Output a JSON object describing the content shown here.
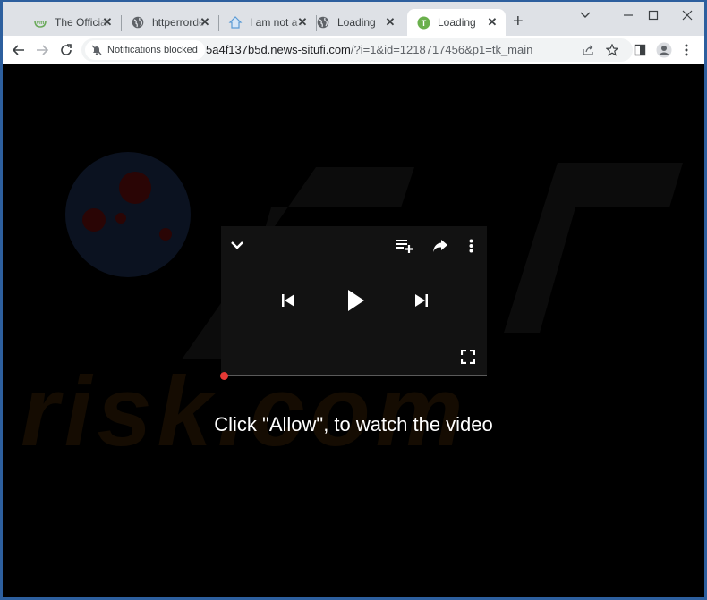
{
  "browser": {
    "tabs": [
      {
        "title": "The Official",
        "favicon": "vm-logo-icon",
        "active": false
      },
      {
        "title": "httperrorde",
        "favicon": "globe-icon",
        "active": false
      },
      {
        "title": "I am not a ro",
        "favicon": "house-icon",
        "active": false
      },
      {
        "title": "Loading",
        "favicon": "globe-icon",
        "active": false
      },
      {
        "title": "Loading",
        "favicon": "green-t-icon",
        "active": true
      }
    ],
    "new_tab_label": "+",
    "notifications_chip": "Notifications blocked",
    "url_host": "5a4f137b5d.news-situfi.com",
    "url_rest": "/?i=1&id=1218717456&p1=tk_main"
  },
  "page": {
    "cta_text": "Click \"Allow\", to watch the video",
    "watermark_text": "risk.com",
    "player": {
      "progress_fraction": 0.0,
      "accent_color": "#e53935"
    }
  }
}
